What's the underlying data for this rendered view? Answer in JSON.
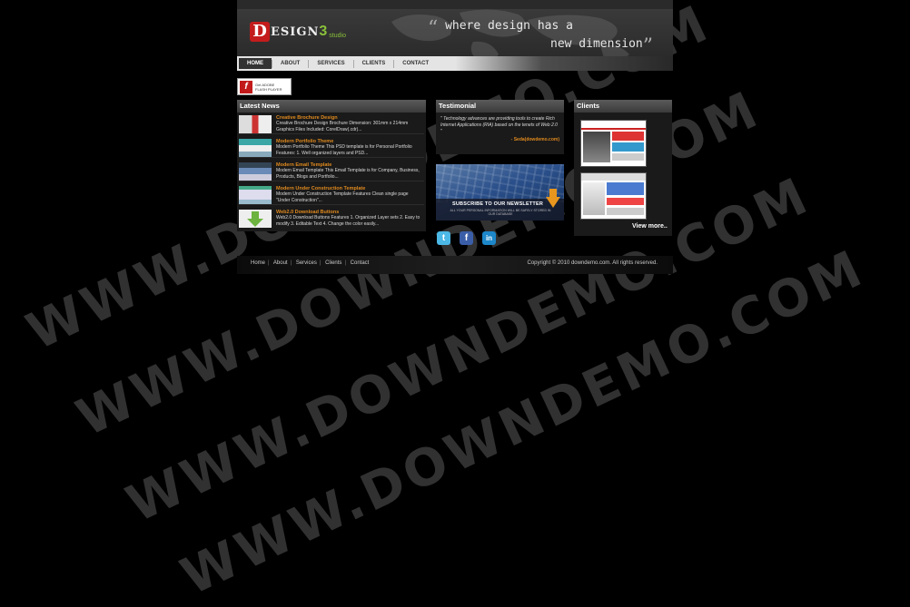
{
  "header": {
    "logo_letter": "D",
    "logo_text": "ESIGN",
    "logo_number": "3",
    "logo_suffix": "studio",
    "tagline_line1": "where design has a",
    "tagline_line2": "new dimension",
    "open_quote": "“",
    "close_quote": "”"
  },
  "nav": {
    "items": [
      {
        "label": "HOME",
        "active": true
      },
      {
        "label": "ABOUT"
      },
      {
        "label": "SERVICES"
      },
      {
        "label": "CLIENTS"
      },
      {
        "label": "CONTACT"
      }
    ]
  },
  "flash_badge": {
    "line1": "Get ADOBE",
    "line2": "FLASH PLAYER"
  },
  "latest_news": {
    "heading": "Latest News",
    "items": [
      {
        "title": "Creative Brochure Design",
        "desc": "Creative Brochure Design Brochure Dimension: 301mm x 214mm Graphics Files Included: CorelDraw(.cdr)..."
      },
      {
        "title": "Modern Portfolio Theme",
        "desc": "Modern Portfolio Theme This PSD template is for Personal Portfolio Features: 1. Well organized layers and PSD..."
      },
      {
        "title": "Modern Email Template",
        "desc": "Modern Email Template This Email Template is for Company, Business, Products, Blogs and Portfolio..."
      },
      {
        "title": "Modern Under Construction Template",
        "desc": "Modern Under Construction Template Features Clean single page \"Under Construction\"..."
      },
      {
        "title": "Web2.0 Download Buttons",
        "desc": "Web2.0 Download Buttons Features 1. Organized Layer sets 2. Easy to modify 3. Editable Text 4. Change the color easily..."
      }
    ]
  },
  "testimonial": {
    "heading": "Testimonial",
    "quote": "\" Technology advances are providing tools to create Rich Internet Applications (RIA) based on the tenets of Web 2.0 \"",
    "author": "- Seda(dowdemo.com)"
  },
  "newsletter": {
    "label": "SUBSCRIBE TO OUR NEWSLETTER",
    "sub": "ALL YOUR PERSONAL INFORMATION WILL BE SAFELY STORED IN OUR DATABASE"
  },
  "social": {
    "twitter": "t",
    "facebook": "f",
    "linkedin": "in"
  },
  "clients": {
    "heading": "Clients",
    "view_more": "View more.."
  },
  "footer": {
    "links": [
      "Home",
      "About",
      "Services",
      "Clients",
      "Contact"
    ],
    "copyright": "Copyright © 2010 downdemo.com. All rights reserved."
  },
  "watermark": "WWW.DOWNDEMO.COM"
}
